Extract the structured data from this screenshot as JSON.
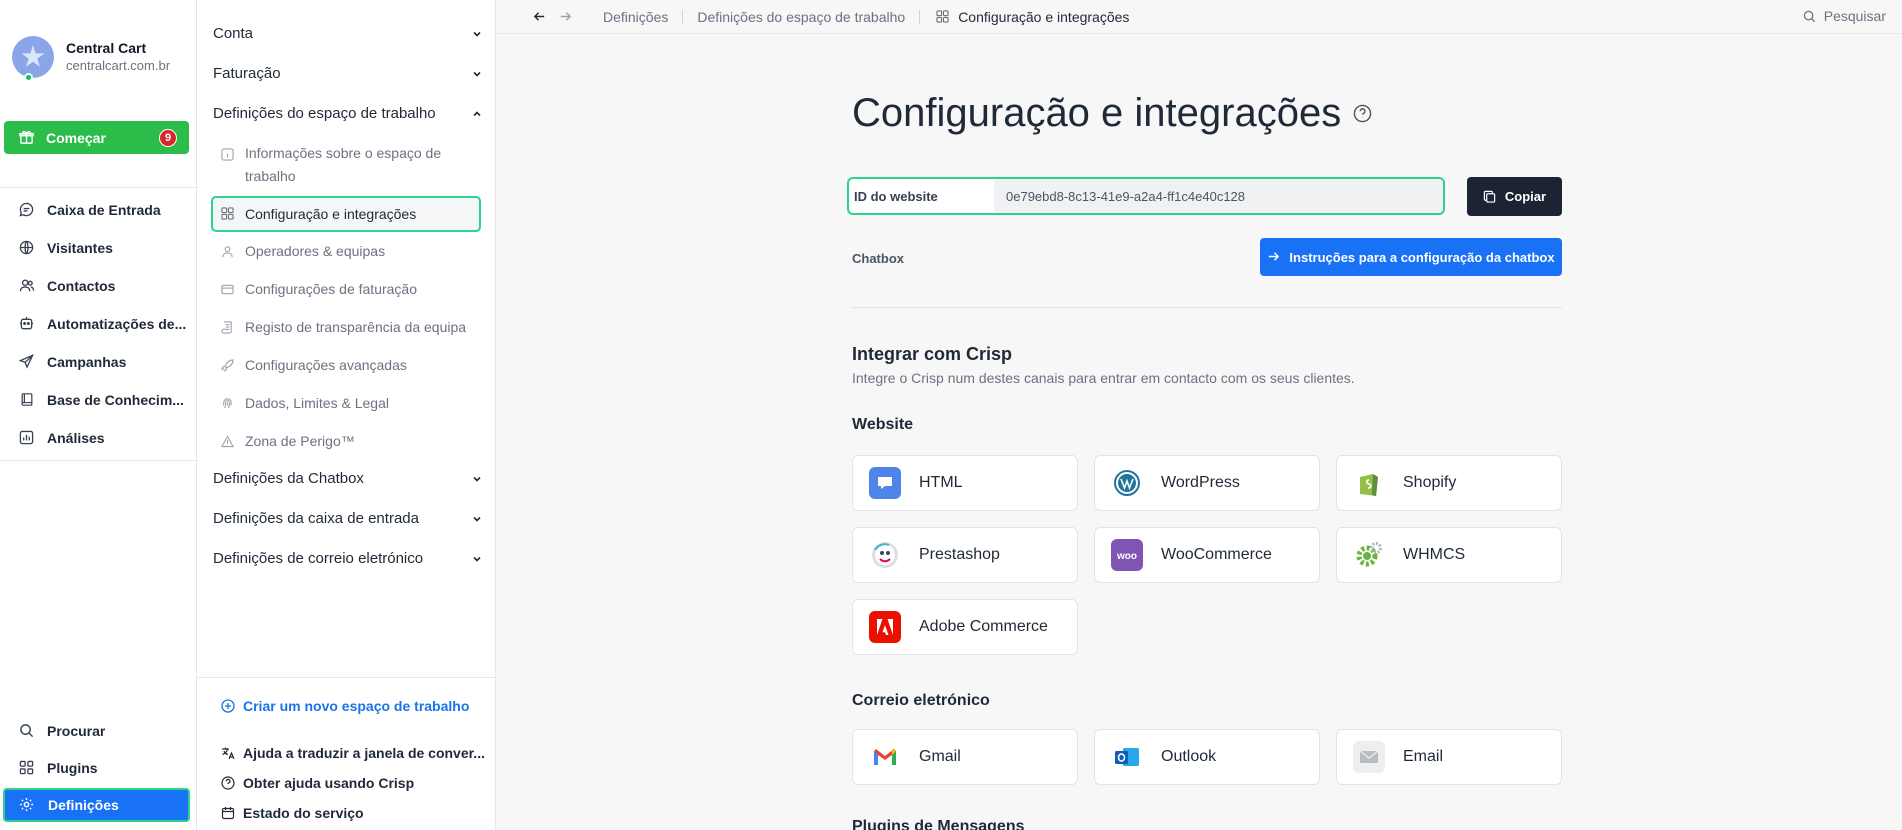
{
  "workspace": {
    "name": "Central Cart",
    "domain": "centralcart.com.br"
  },
  "sidebar": {
    "start": {
      "label": "Começar",
      "badge": "9"
    },
    "items": [
      {
        "label": "Caixa de Entrada",
        "icon": "chat-icon"
      },
      {
        "label": "Visitantes",
        "icon": "globe-icon"
      },
      {
        "label": "Contactos",
        "icon": "users-icon"
      },
      {
        "label": "Automatizações de...",
        "icon": "bot-icon"
      },
      {
        "label": "Campanhas",
        "icon": "send-icon"
      },
      {
        "label": "Base de Conhecim...",
        "icon": "book-icon"
      },
      {
        "label": "Análises",
        "icon": "chart-icon"
      }
    ],
    "bottom": [
      {
        "label": "Procurar",
        "icon": "search-icon"
      },
      {
        "label": "Plugins",
        "icon": "plugins-icon"
      }
    ],
    "settings": {
      "label": "Definições"
    }
  },
  "panel": {
    "sections": {
      "account": "Conta",
      "billing": "Faturação",
      "workspace": "Definições do espaço de trabalho",
      "chatbox": "Definições da Chatbox",
      "inbox": "Definições da caixa de entrada",
      "email": "Definições de correio eletrónico"
    },
    "subs": {
      "info": "Informações sobre o espaço de trabalho",
      "config": "Configuração e integrações",
      "operators": "Operadores & equipas",
      "billing_cfg": "Configurações de faturação",
      "audit": "Registo de transparência da equipa",
      "advanced": "Configurações avançadas",
      "data": "Dados, Limites & Legal",
      "danger": "Zona de Perigo™"
    },
    "create": "Criar um novo espaço de trabalho",
    "help": {
      "translate": "Ajuda a traduzir a janela de conver...",
      "support": "Obter ajuda usando Crisp",
      "status": "Estado do serviço"
    }
  },
  "topbar": {
    "crumbs": [
      "Definições",
      "Definições do espaço de trabalho",
      "Configuração e integrações"
    ],
    "search": "Pesquisar"
  },
  "main": {
    "title": "Configuração e integrações",
    "website_id": {
      "label": "ID do website",
      "value": "0e79ebd8-8c13-41e9-a2a4-ff1c4e40c128"
    },
    "copy": "Copiar",
    "chatbox_label": "Chatbox",
    "instructions": "Instruções para a configuração da chatbox",
    "integrate_title": "Integrar com Crisp",
    "integrate_subtitle": "Integre o Crisp num destes canais para entrar em contacto com os seus clientes.",
    "website_title": "Website",
    "website_cards": [
      "HTML",
      "WordPress",
      "Shopify",
      "Prestashop",
      "WooCommerce",
      "WHMCS",
      "Adobe Commerce"
    ],
    "email_title": "Correio eletrónico",
    "email_cards": [
      "Gmail",
      "Outlook",
      "Email"
    ],
    "plugins_title": "Plugins de Mensagens"
  },
  "colors": {
    "accent": "#1972f5",
    "green": "#2cbc4a",
    "highlight": "#2bd48a",
    "dark": "#1c2433"
  }
}
